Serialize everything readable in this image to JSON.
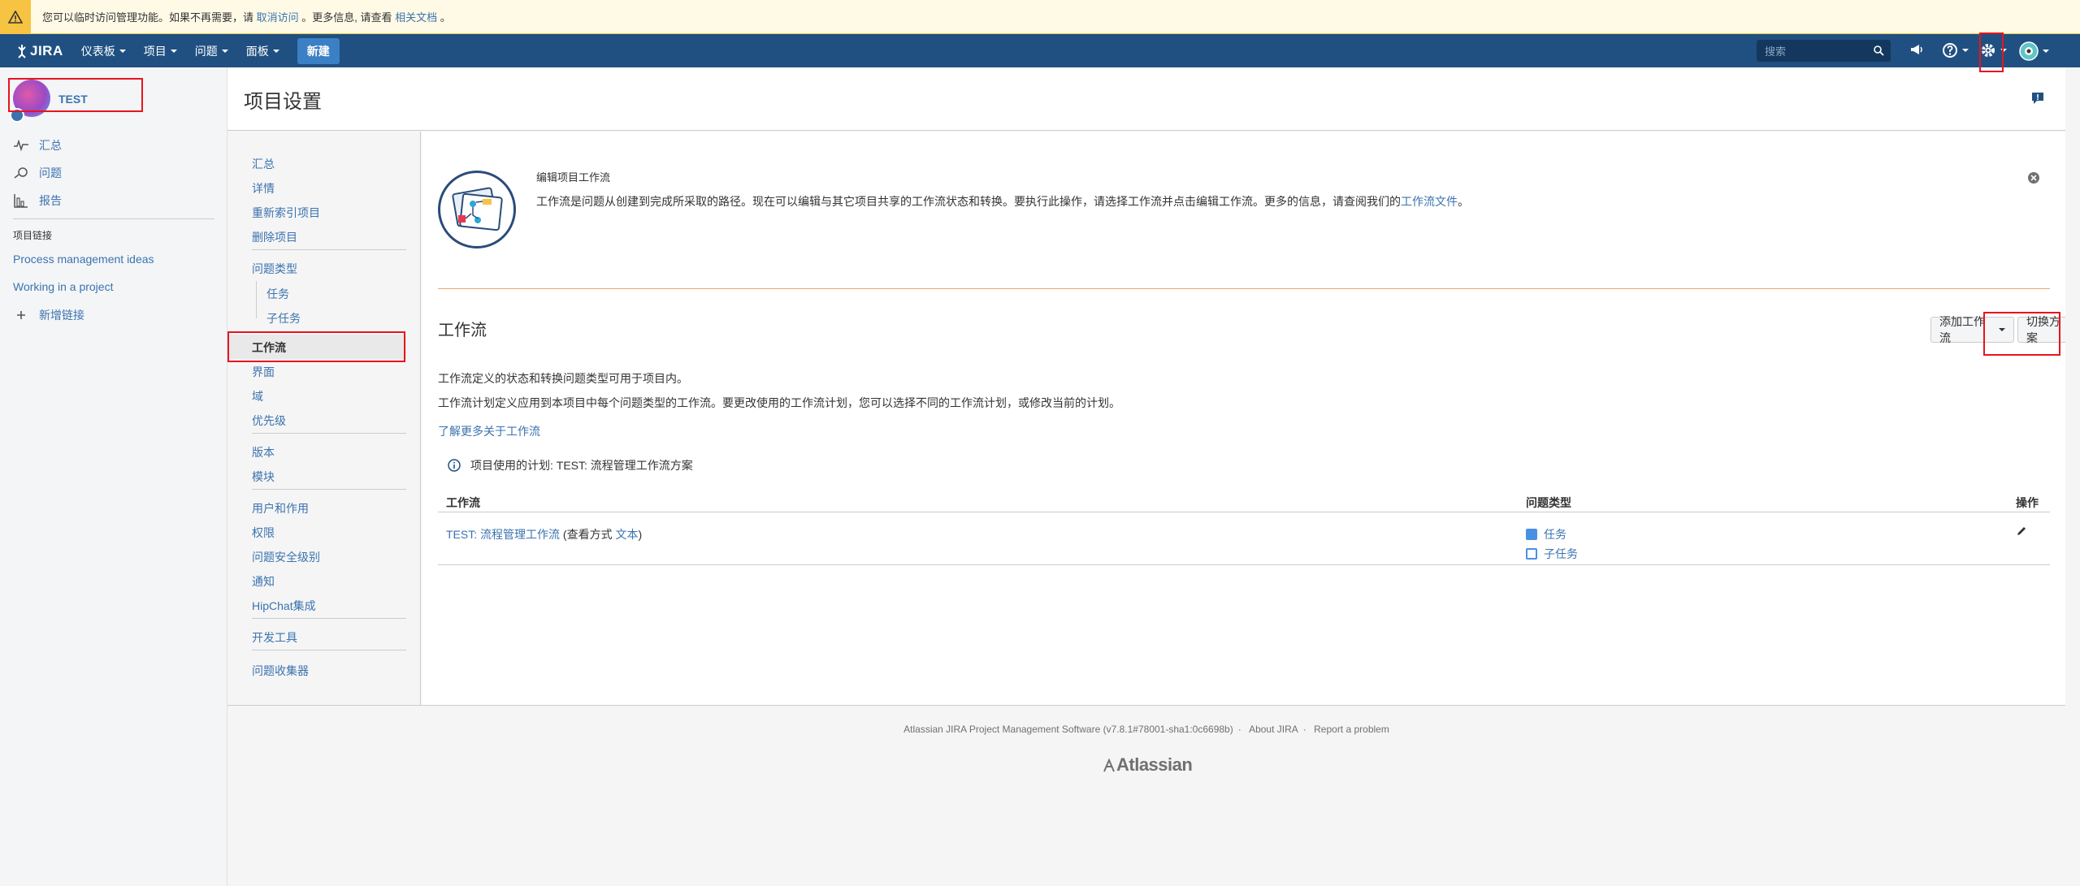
{
  "banner": {
    "text_before": "您可以临时访问管理功能。如果不再需要，请",
    "link1": "取消访问",
    "text_middle": "。更多信息, 请查看",
    "link2": "相关文档",
    "text_after": "。"
  },
  "topnav": {
    "logo": "JIRA",
    "items": [
      "仪表板",
      "项目",
      "问题",
      "面板"
    ],
    "create": "新建",
    "search_placeholder": "搜索"
  },
  "sidebar": {
    "project_name": "TEST",
    "links": [
      "汇总",
      "问题",
      "报告"
    ],
    "section_title": "项目链接",
    "project_links": [
      "Process management ideas",
      "Working in a project"
    ],
    "add_link": "新增链接"
  },
  "page": {
    "title": "项目设置"
  },
  "admin_nav": {
    "group1": [
      "汇总",
      "详情",
      "重新索引项目",
      "删除项目"
    ],
    "issue_types": "问题类型",
    "issue_type_subs": [
      "任务",
      "子任务"
    ],
    "active": "工作流",
    "group2": [
      "界面",
      "域",
      "优先级"
    ],
    "group3": [
      "版本",
      "模块"
    ],
    "group4": [
      "用户和作用",
      "权限",
      "问题安全级别",
      "通知",
      "HipChat集成"
    ],
    "group5": [
      "开发工具"
    ],
    "group6": [
      "问题收集器"
    ]
  },
  "intro": {
    "title": "编辑项目工作流",
    "text": "工作流是问题从创建到完成所采取的路径。现在可以编辑与其它项目共享的工作流状态和转换。要执行此操作，请选择工作流并点击编辑工作流。更多的信息，请查阅我们的",
    "link": "工作流文件",
    "text_end": "。"
  },
  "workflow": {
    "title": "工作流",
    "add_button": "添加工作流",
    "switch_button": "切换方案",
    "p1": "工作流定义的状态和转换问题类型可用于项目内。",
    "p2": "工作流计划定义应用到本项目中每个问题类型的工作流。要更改使用的工作流计划，您可以选择不同的工作流计划，或修改当前的计划。",
    "learn_more": "了解更多关于工作流",
    "scheme_info": "项目使用的计划: TEST: 流程管理工作流方案",
    "table": {
      "headers": [
        "工作流",
        "问题类型",
        "操作"
      ],
      "row": {
        "name": "TEST: 流程管理工作流",
        "view_prefix": "(查看方式",
        "view_link": "文本",
        "view_suffix": ")",
        "issue_types": [
          "任务",
          "子任务"
        ]
      }
    }
  },
  "footer": {
    "version": "Atlassian JIRA Project Management Software (v7.8.1#78001-sha1:0c6698b)",
    "about": "About JIRA",
    "report": "Report a problem",
    "logo": "Atlassian"
  },
  "colors": {
    "nav_bg": "#205081",
    "link": "#3b73af",
    "highlight": "#e8141e",
    "warning": "#f6c342"
  }
}
